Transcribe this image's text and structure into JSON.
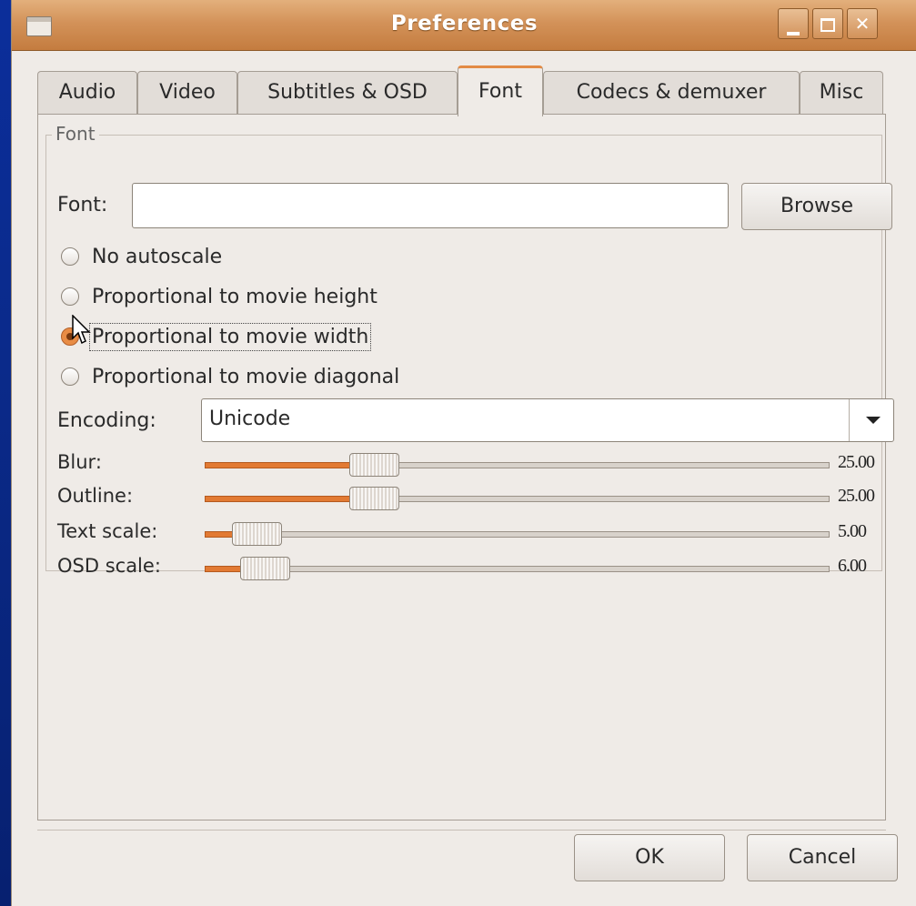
{
  "window": {
    "title": "Preferences"
  },
  "tabs": [
    "Audio",
    "Video",
    "Subtitles & OSD",
    "Font",
    "Codecs & demuxer",
    "Misc"
  ],
  "active_tab": "Font",
  "font_frame": {
    "label": "Font",
    "font_label": "Font:",
    "font_value": "",
    "browse_label": "Browse",
    "radios": [
      {
        "label": "No autoscale",
        "checked": false
      },
      {
        "label": "Proportional to movie height",
        "checked": false
      },
      {
        "label": "Proportional to movie width",
        "checked": true
      },
      {
        "label": "Proportional to movie diagonal",
        "checked": false
      }
    ],
    "encoding_label": "Encoding:",
    "encoding_value": "Unicode",
    "sliders": [
      {
        "label": "Blur:",
        "value": "25.00",
        "fraction": 0.25
      },
      {
        "label": "Outline:",
        "value": "25.00",
        "fraction": 0.25
      },
      {
        "label": "Text scale:",
        "value": "5.00",
        "fraction": 0.063
      },
      {
        "label": "OSD scale:",
        "value": "6.00",
        "fraction": 0.075
      }
    ]
  },
  "buttons": {
    "ok": "OK",
    "cancel": "Cancel"
  },
  "colors": {
    "accent": "#e27a33",
    "titlebar": "#d39259",
    "desktop": "#0a2a8a"
  }
}
